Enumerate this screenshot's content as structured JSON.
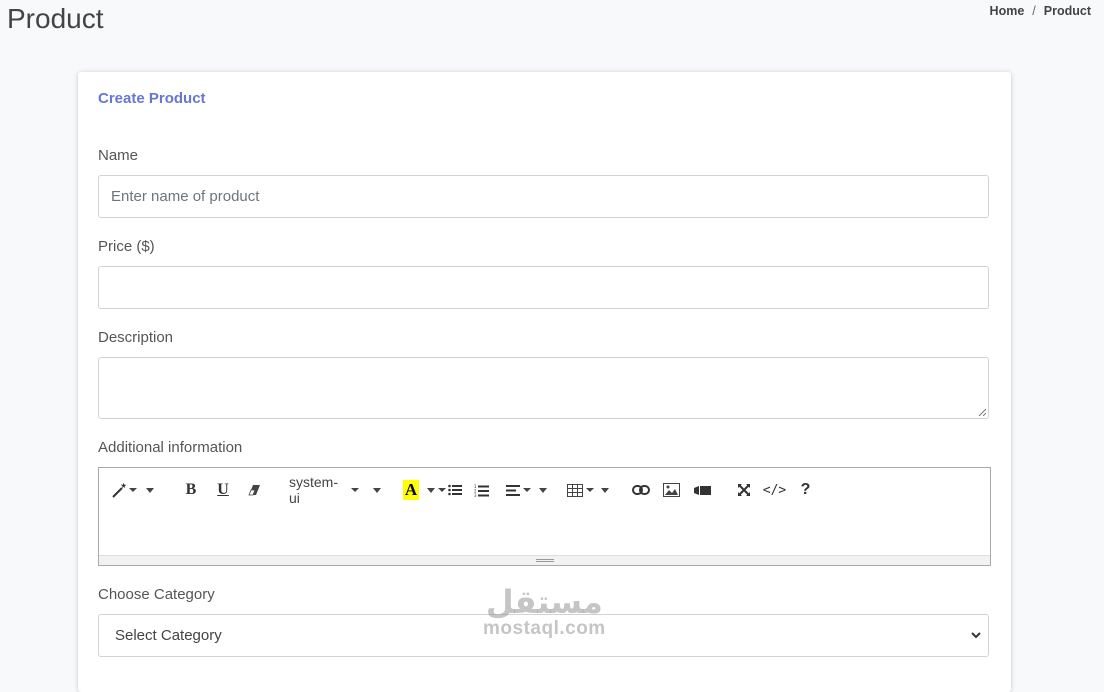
{
  "page": {
    "title": "Product"
  },
  "breadcrumb": {
    "home": "Home",
    "separator": "/",
    "current": "Product"
  },
  "form": {
    "title": "Create Product",
    "name_label": "Name",
    "name_placeholder": "Enter name of product",
    "price_label": "Price ($)",
    "price_value": "",
    "description_label": "Description",
    "description_value": "",
    "additional_label": "Additional information",
    "category_label": "Choose Category",
    "category_selected": "Select Category"
  },
  "editor": {
    "font_name": "system-ui",
    "font_color_letter": "A",
    "highlight_color": "#ffff00",
    "icons": [
      "magic-icon",
      "bold-icon",
      "underline-icon",
      "eraser-icon",
      "font-color-icon",
      "unordered-list-icon",
      "ordered-list-icon",
      "align-icon",
      "table-icon",
      "link-icon",
      "picture-icon",
      "video-icon",
      "fullscreen-icon",
      "code-view-icon",
      "help-icon"
    ],
    "bold_letter": "B",
    "underline_letter": "U",
    "code_view": "</>",
    "help": "?"
  },
  "watermark": {
    "arabic": "مستقل",
    "latin": "mostaql.com"
  },
  "colors": {
    "accent": "#6777d0",
    "background": "#f8f9fa"
  }
}
